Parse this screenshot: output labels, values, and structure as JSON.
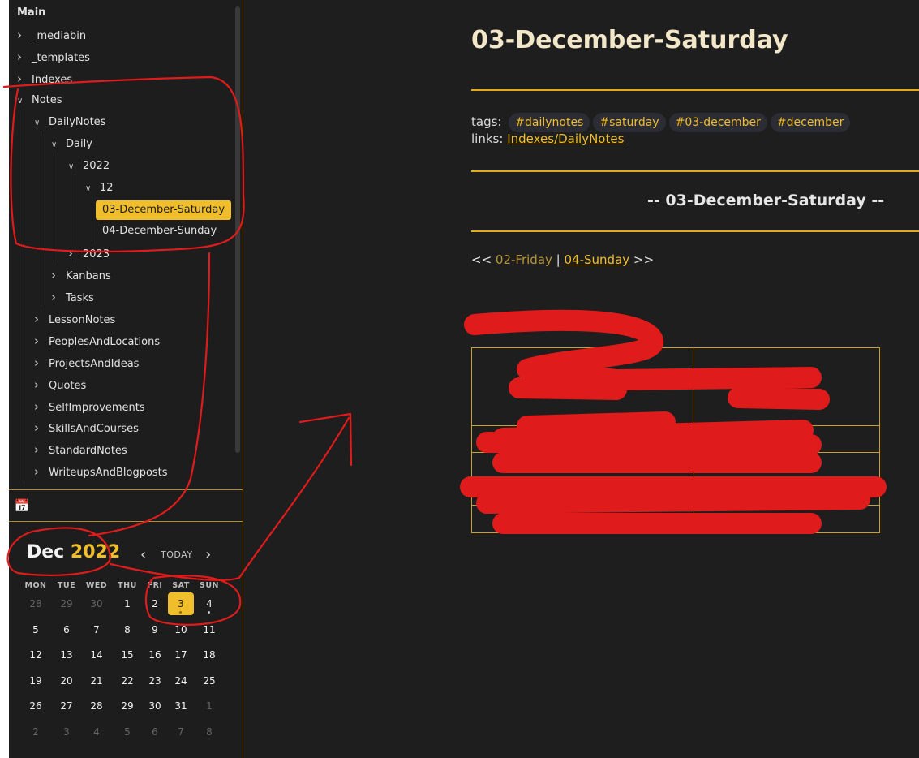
{
  "sidebar": {
    "root": "Main",
    "items": [
      {
        "label": "_mediabin",
        "chevron": "right"
      },
      {
        "label": "_templates",
        "chevron": "right"
      },
      {
        "label": "Indexes",
        "chevron": "right"
      },
      {
        "label": "Notes",
        "chevron": "down"
      },
      {
        "label": "DailyNotes",
        "chevron": "down"
      },
      {
        "label": "Daily",
        "chevron": "down"
      },
      {
        "label": "2022",
        "chevron": "down"
      },
      {
        "label": "12",
        "chevron": "down"
      },
      {
        "label": "03-December-Saturday",
        "chevron": ""
      },
      {
        "label": "04-December-Sunday",
        "chevron": ""
      },
      {
        "label": "2023",
        "chevron": "right"
      },
      {
        "label": "Kanbans",
        "chevron": "right"
      },
      {
        "label": "Tasks",
        "chevron": "right"
      },
      {
        "label": "LessonNotes",
        "chevron": "right"
      },
      {
        "label": "PeoplesAndLocations",
        "chevron": "right"
      },
      {
        "label": "ProjectsAndIdeas",
        "chevron": "right"
      },
      {
        "label": "Quotes",
        "chevron": "right"
      },
      {
        "label": "SelfImprovements",
        "chevron": "right"
      },
      {
        "label": "SkillsAndCourses",
        "chevron": "right"
      },
      {
        "label": "StandardNotes",
        "chevron": "right"
      },
      {
        "label": "WriteupsAndBlogposts",
        "chevron": "right"
      }
    ]
  },
  "calendar": {
    "month": "Dec",
    "year": "2022",
    "today_label": "TODAY",
    "weekdays": [
      "MON",
      "TUE",
      "WED",
      "THU",
      "FRI",
      "SAT",
      "SUN"
    ],
    "weeks": [
      [
        "28",
        "29",
        "30",
        "1",
        "2",
        "3",
        "4"
      ],
      [
        "5",
        "6",
        "7",
        "8",
        "9",
        "10",
        "11"
      ],
      [
        "12",
        "13",
        "14",
        "15",
        "16",
        "17",
        "18"
      ],
      [
        "19",
        "20",
        "21",
        "22",
        "23",
        "24",
        "25"
      ],
      [
        "26",
        "27",
        "28",
        "29",
        "30",
        "31",
        "1"
      ],
      [
        "2",
        "3",
        "4",
        "5",
        "6",
        "7",
        "8"
      ]
    ],
    "selected": "3",
    "dots": [
      "3",
      "4"
    ]
  },
  "note": {
    "title": "03-December-Saturday",
    "tags_label": "tags:",
    "tags": [
      "#dailynotes",
      "#saturday",
      "#03-december",
      "#december"
    ],
    "links_label": "links:",
    "link": "Indexes/DailyNotes",
    "heading": "-- 03-December-Saturday --",
    "nav_prefix": "<<",
    "nav_prev": "02-Friday",
    "nav_sep": "|",
    "nav_next": "04-Sunday",
    "nav_suffix": ">>"
  },
  "colors": {
    "accent": "#f0bd2b",
    "annotation": "#e01b1b"
  }
}
